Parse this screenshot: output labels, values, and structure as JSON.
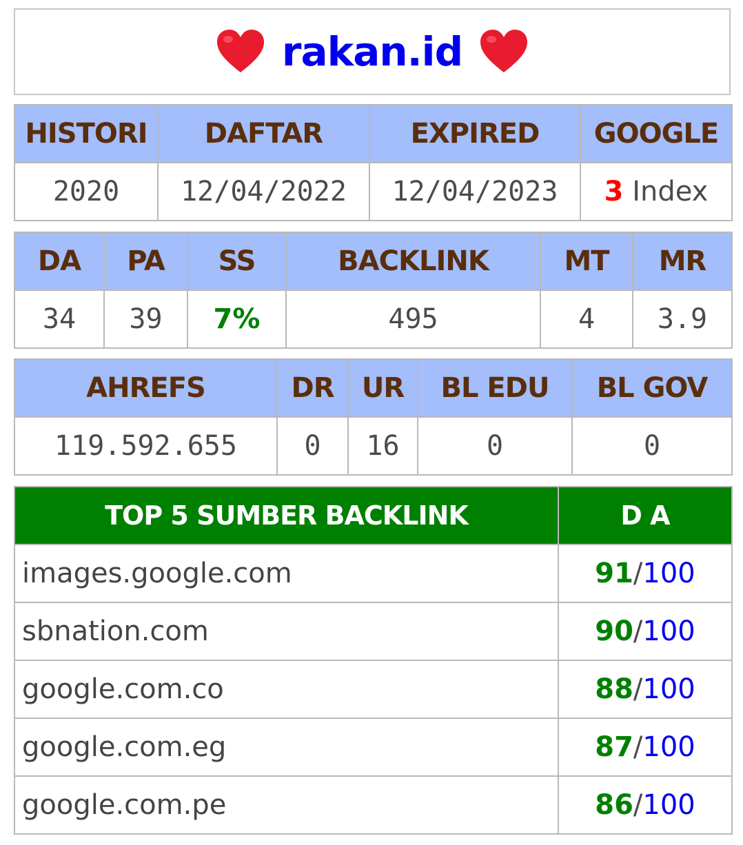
{
  "title": "rakan.id",
  "colors": {
    "heart": "#e81c2e",
    "header_blue": "#a4bdfb",
    "header_text": "#5a2e0c",
    "green": "#008000",
    "blue": "#0000ee",
    "red": "#ff0000"
  },
  "icons": {
    "left": "heart-icon",
    "right": "heart-icon"
  },
  "t1": {
    "headers": [
      "HISTORI",
      "DAFTAR",
      "EXPIRED",
      "GOOGLE"
    ],
    "histori": "2020",
    "daftar": "12/04/2022",
    "expired": "12/04/2023",
    "google_count": "3",
    "google_suffix": " Index"
  },
  "t2": {
    "headers": [
      "DA",
      "PA",
      "SS",
      "BACKLINK",
      "MT",
      "MR"
    ],
    "values": [
      "34",
      "39",
      "7%",
      "495",
      "4",
      "3.9"
    ]
  },
  "t3": {
    "headers": [
      "AHREFS",
      "DR",
      "UR",
      "BL EDU",
      "BL GOV"
    ],
    "values": [
      "119.592.655",
      "0",
      "16",
      "0",
      "0"
    ]
  },
  "t4": {
    "headers": [
      "TOP 5 SUMBER BACKLINK",
      "D A"
    ],
    "max": "100",
    "rows": [
      {
        "site": "images.google.com",
        "da": "91"
      },
      {
        "site": "sbnation.com",
        "da": "90"
      },
      {
        "site": "google.com.co",
        "da": "88"
      },
      {
        "site": "google.com.eg",
        "da": "87"
      },
      {
        "site": "google.com.pe",
        "da": "86"
      }
    ]
  }
}
